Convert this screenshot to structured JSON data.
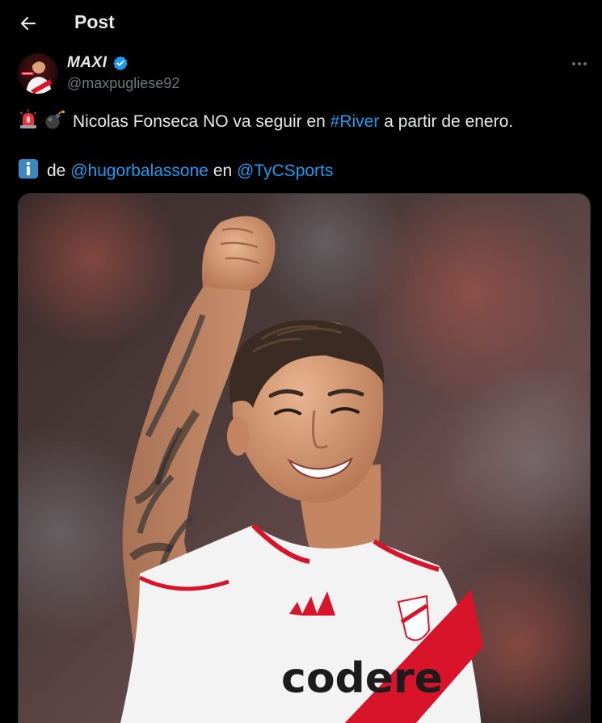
{
  "header": {
    "title": "Post"
  },
  "author": {
    "name": "MAXI",
    "handle": "@maxpugliese92",
    "verified": true
  },
  "tweet": {
    "line1": {
      "text": "Nicolas Fonseca NO va seguir en",
      "hashtag": "#River",
      "tail": "a partir de enero."
    },
    "line2": {
      "prefix": "de",
      "mention1": "@hugorbalassone",
      "connector": "en",
      "mention2": "@TyCSports"
    }
  },
  "media": {
    "jersey_text": "codere"
  },
  "colors": {
    "background": "#000000",
    "text": "#e7e9ea",
    "muted": "#71767b",
    "link": "#1d9bf0",
    "verified": "#1d9bf0"
  },
  "icons": {
    "back": "arrow-left-icon",
    "verified": "verified-badge-icon",
    "more": "more-horizontal-icon",
    "emoji1": "siren-emoji-icon",
    "emoji2": "bomb-emoji-icon",
    "emoji3": "information-emoji-icon"
  }
}
